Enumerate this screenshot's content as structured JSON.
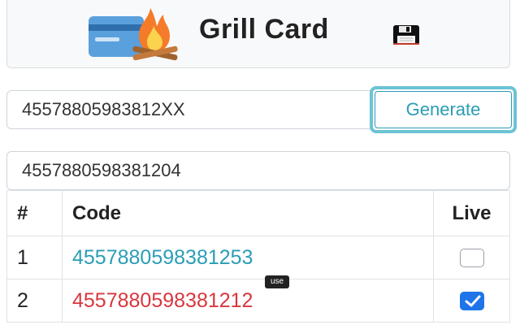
{
  "header": {
    "title": "Grill Card",
    "logo_icon": "credit-card-campfire-icon",
    "save_icon": "floppy-disk-icon"
  },
  "pattern_input": {
    "value": "45578805983812XX"
  },
  "generate_button": {
    "label": "Generate"
  },
  "result_input": {
    "value": "4557880598381204"
  },
  "table": {
    "headers": {
      "num": "#",
      "code": "Code",
      "live": "Live"
    },
    "rows": [
      {
        "num": "1",
        "code": "4557880598381253",
        "live": false
      },
      {
        "num": "2",
        "code": "4557880598381212",
        "live": true
      }
    ]
  },
  "tooltip": {
    "text": "use"
  },
  "colors": {
    "accent": "#2a9db5",
    "dead": "#d9363e",
    "check": "#1e74e8",
    "focus_ring": "#6cc3d5"
  }
}
